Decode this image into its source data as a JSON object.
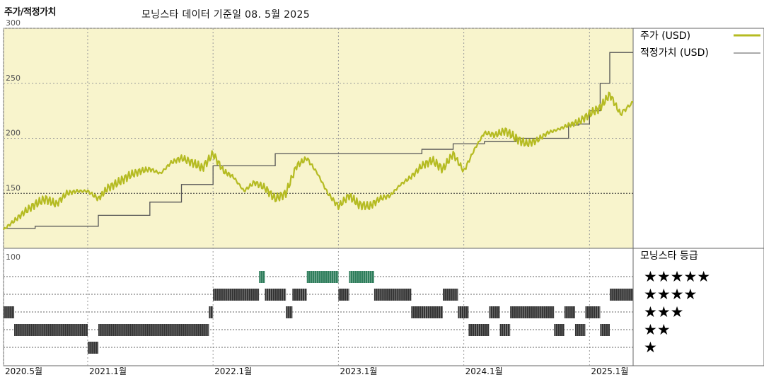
{
  "header": {
    "title": "주가/적정가치",
    "subtitle": "모닝스타 데이터 기준일 08. 5월 2025"
  },
  "legend": {
    "price_label": "주가 (USD)",
    "fair_label": "적정가치 (USD)",
    "rating_title": "모닝스타 등급",
    "stars": [
      "★★★★★",
      "★★★★",
      "★★★",
      "★★",
      "★"
    ]
  },
  "colors": {
    "price": "#b5bb22",
    "fair": "#555555",
    "panel_bg": "#f8f4cc",
    "rating_bar": "#333333",
    "rating_5star": "#2e7d5b"
  },
  "chart_data": [
    {
      "type": "line",
      "title": "주가/적정가치",
      "y_ticks": [
        150,
        200,
        250,
        300
      ],
      "ylim": [
        100,
        300
      ],
      "x_ticks": [
        "2020.5월",
        "2021.1월",
        "2022.1월",
        "2023.1월",
        "2024.1월",
        "2025.1월"
      ],
      "x_tick_dates": [
        "2020-05-01",
        "2021-01-01",
        "2022-01-01",
        "2023-01-01",
        "2024-01-01",
        "2025-01-01"
      ],
      "xlim": [
        "2020-05-01",
        "2025-05-08"
      ],
      "grid": true,
      "series": [
        {
          "name": "주가 (USD)",
          "x": [
            "2020-05-01",
            "2020-06-01",
            "2020-07-01",
            "2020-08-01",
            "2020-09-01",
            "2020-10-01",
            "2020-11-01",
            "2020-12-01",
            "2021-01-01",
            "2021-02-01",
            "2021-03-01",
            "2021-04-01",
            "2021-05-01",
            "2021-06-01",
            "2021-07-01",
            "2021-08-01",
            "2021-09-01",
            "2021-10-01",
            "2021-11-01",
            "2021-12-01",
            "2022-01-01",
            "2022-02-01",
            "2022-03-01",
            "2022-04-01",
            "2022-05-01",
            "2022-06-01",
            "2022-07-01",
            "2022-08-01",
            "2022-09-01",
            "2022-10-01",
            "2022-11-01",
            "2022-12-01",
            "2023-01-01",
            "2023-02-01",
            "2023-03-01",
            "2023-04-01",
            "2023-05-01",
            "2023-06-01",
            "2023-07-01",
            "2023-08-01",
            "2023-09-01",
            "2023-10-01",
            "2023-11-01",
            "2023-12-01",
            "2024-01-01",
            "2024-02-01",
            "2024-03-01",
            "2024-04-01",
            "2024-05-01",
            "2024-06-01",
            "2024-07-01",
            "2024-08-01",
            "2024-09-01",
            "2024-10-01",
            "2024-11-01",
            "2024-12-01",
            "2025-01-01",
            "2025-02-01",
            "2025-03-01",
            "2025-04-01",
            "2025-05-08"
          ],
          "y": [
            117,
            125,
            133,
            140,
            145,
            140,
            150,
            152,
            152,
            145,
            155,
            160,
            166,
            170,
            172,
            168,
            178,
            182,
            178,
            173,
            186,
            170,
            165,
            152,
            160,
            155,
            145,
            150,
            175,
            182,
            168,
            150,
            138,
            148,
            140,
            138,
            145,
            148,
            158,
            165,
            175,
            180,
            172,
            186,
            170,
            190,
            205,
            203,
            207,
            200,
            195,
            198,
            205,
            208,
            212,
            215,
            222,
            228,
            240,
            222,
            233
          ],
          "x_unit": "date",
          "y_unit": "USD"
        },
        {
          "name": "적정가치 (USD)",
          "x": [
            "2020-05-01",
            "2020-08-01",
            "2020-08-01",
            "2021-02-01",
            "2021-02-01",
            "2021-07-01",
            "2021-07-01",
            "2021-10-01",
            "2021-10-01",
            "2022-01-01",
            "2022-01-01",
            "2022-07-01",
            "2022-07-01",
            "2023-09-01",
            "2023-09-01",
            "2023-12-01",
            "2023-12-01",
            "2024-03-01",
            "2024-03-01",
            "2024-06-01",
            "2024-06-01",
            "2024-11-01",
            "2024-11-01",
            "2024-12-01",
            "2024-12-01",
            "2025-01-01",
            "2025-01-01",
            "2025-02-01",
            "2025-02-01",
            "2025-03-01",
            "2025-03-01",
            "2025-05-08"
          ],
          "y": [
            118,
            118,
            120,
            120,
            130,
            130,
            142,
            142,
            158,
            158,
            175,
            175,
            186,
            186,
            190,
            190,
            195,
            195,
            197,
            197,
            200,
            200,
            212,
            212,
            213,
            213,
            225,
            225,
            250,
            250,
            278,
            278
          ],
          "x_unit": "date",
          "y_unit": "USD"
        }
      ]
    },
    {
      "type": "bar",
      "title": "모닝스타 등급",
      "y_ticks": [
        100
      ],
      "levels": [
        "★★★★★",
        "★★★★",
        "★★★",
        "★★",
        "★"
      ],
      "periods": [
        {
          "start": "2020-05-01",
          "end": "2020-06-01",
          "stars": 3
        },
        {
          "start": "2020-06-01",
          "end": "2021-01-01",
          "stars": 2
        },
        {
          "start": "2021-01-01",
          "end": "2021-02-01",
          "stars": 1
        },
        {
          "start": "2021-02-01",
          "end": "2021-12-20",
          "stars": 2
        },
        {
          "start": "2021-12-20",
          "end": "2022-01-01",
          "stars": 3
        },
        {
          "start": "2022-01-01",
          "end": "2022-05-15",
          "stars": 4
        },
        {
          "start": "2022-05-15",
          "end": "2022-06-01",
          "stars": 5
        },
        {
          "start": "2022-06-01",
          "end": "2022-08-01",
          "stars": 4
        },
        {
          "start": "2022-08-01",
          "end": "2022-08-20",
          "stars": 3
        },
        {
          "start": "2022-08-20",
          "end": "2022-10-01",
          "stars": 4
        },
        {
          "start": "2022-10-01",
          "end": "2023-01-01",
          "stars": 5
        },
        {
          "start": "2023-01-01",
          "end": "2023-02-01",
          "stars": 4
        },
        {
          "start": "2023-02-01",
          "end": "2023-04-15",
          "stars": 5
        },
        {
          "start": "2023-04-15",
          "end": "2023-08-01",
          "stars": 4
        },
        {
          "start": "2023-08-01",
          "end": "2023-11-01",
          "stars": 3
        },
        {
          "start": "2023-11-01",
          "end": "2023-12-15",
          "stars": 4
        },
        {
          "start": "2023-12-15",
          "end": "2024-01-15",
          "stars": 3
        },
        {
          "start": "2024-01-15",
          "end": "2024-03-15",
          "stars": 2
        },
        {
          "start": "2024-03-15",
          "end": "2024-04-15",
          "stars": 3
        },
        {
          "start": "2024-04-15",
          "end": "2024-05-15",
          "stars": 2
        },
        {
          "start": "2024-05-15",
          "end": "2024-09-20",
          "stars": 3
        },
        {
          "start": "2024-09-20",
          "end": "2024-10-20",
          "stars": 2
        },
        {
          "start": "2024-10-20",
          "end": "2024-11-20",
          "stars": 3
        },
        {
          "start": "2024-11-20",
          "end": "2024-12-20",
          "stars": 2
        },
        {
          "start": "2024-12-20",
          "end": "2025-02-01",
          "stars": 3
        },
        {
          "start": "2025-02-01",
          "end": "2025-03-01",
          "stars": 2
        },
        {
          "start": "2025-03-01",
          "end": "2025-05-08",
          "stars": 4
        }
      ]
    }
  ]
}
